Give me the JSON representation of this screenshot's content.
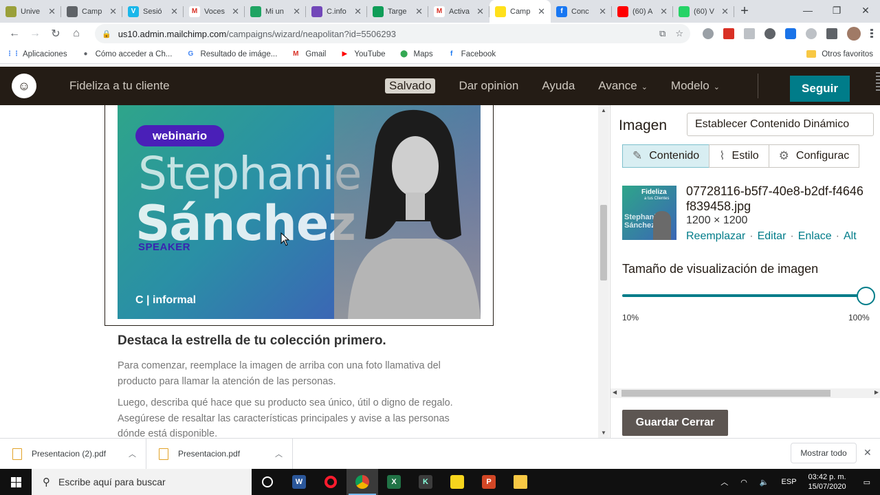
{
  "browser": {
    "tabs": [
      {
        "title": "Unive",
        "color": "#9aa03a",
        "glyph": "",
        "active": false
      },
      {
        "title": "Camp",
        "color": "#5f6368",
        "glyph": "",
        "active": false
      },
      {
        "title": "Sesió",
        "color": "#1ab7ea",
        "glyph": "V",
        "active": false
      },
      {
        "title": "Voces",
        "color": "#ffffff",
        "glyph": "M",
        "active": false
      },
      {
        "title": "Mi un",
        "color": "#1fa463",
        "glyph": "",
        "active": false
      },
      {
        "title": "C.info",
        "color": "#7248b9",
        "glyph": "",
        "active": false
      },
      {
        "title": "Targe",
        "color": "#0f9d58",
        "glyph": "",
        "active": false
      },
      {
        "title": "Activa",
        "color": "#ffffff",
        "glyph": "M",
        "active": false
      },
      {
        "title": "Camp",
        "color": "#ffe01b",
        "glyph": "",
        "active": true
      },
      {
        "title": "Conc",
        "color": "#1877f2",
        "glyph": "f",
        "active": false
      },
      {
        "title": "(60) A",
        "color": "#ff0000",
        "glyph": "",
        "active": false
      },
      {
        "title": "(60) V",
        "color": "#25d366",
        "glyph": "",
        "active": false
      }
    ],
    "new_tab": "+",
    "url_host": "us10.admin.mailchimp.com",
    "url_path": "/campaigns/wizard/neapolitan?id=5506293",
    "bookmarks": [
      {
        "label": "Aplicaciones",
        "icon": "apps-grid-icon"
      },
      {
        "label": "Cómo acceder a Ch...",
        "icon": "globe-icon"
      },
      {
        "label": "Resultado de imáge...",
        "icon": "google-icon"
      },
      {
        "label": "Gmail",
        "icon": "gmail-icon"
      },
      {
        "label": "YouTube",
        "icon": "youtube-icon"
      },
      {
        "label": "Maps",
        "icon": "maps-icon"
      },
      {
        "label": "Facebook",
        "icon": "facebook-icon"
      }
    ],
    "other_bookmarks": "Otros favoritos"
  },
  "mailchimp": {
    "title": "Fideliza a tu cliente",
    "nav": {
      "saved": "Salvado",
      "feedback": "Dar opinion",
      "help": "Ayuda",
      "preview": "Avance",
      "template": "Modelo"
    },
    "continue_button": "Seguir"
  },
  "email": {
    "hero": {
      "pill": "webinario",
      "first_name": "Stephanie",
      "last_name": "Sánchez",
      "role": "SPEAKER",
      "brand": "informal",
      "brand_prefix": "C"
    },
    "heading": "Destaca la estrella de tu colección primero.",
    "para1": "Para comenzar, reemplace la imagen de arriba con una foto llamativa del producto para llamar la atención de las personas.",
    "para2": "Luego, describa qué hace que su producto sea único, útil o digno de regalo. Asegúrese de resaltar las características principales y avise a las personas dónde está disponible."
  },
  "panel": {
    "title": "Imagen",
    "dynamic_button": "Establecer Contenido Dinámico",
    "tabs": [
      "Contenido",
      "Estilo",
      "Configurac"
    ],
    "thumb_title": "Fideliza",
    "thumb_sub": "a tus Clientes",
    "thumb_name": "Stephanie Sánchez",
    "file_name": "07728116-b5f7-40e8-b2df-f4646f839458.jpg",
    "file_dims": "1200 × 1200",
    "actions": [
      "Reemplazar",
      "Editar",
      "Enlace",
      "Alt"
    ],
    "size_label": "Tamaño de visualización de imagen",
    "size_value_pct": 100,
    "slider_min": "10%",
    "slider_max": "100%",
    "save_close": "Guardar Cerrar"
  },
  "downloads": {
    "items": [
      "Presentacion (2).pdf",
      "Presentacion.pdf"
    ],
    "show_all": "Mostrar todo"
  },
  "taskbar": {
    "search_placeholder": "Escribe aquí para buscar",
    "lang": "ESP",
    "time": "03:42 p. m.",
    "date": "15/07/2020"
  },
  "colors": {
    "mailchimp_dark": "#241c15",
    "teal": "#007c89"
  }
}
